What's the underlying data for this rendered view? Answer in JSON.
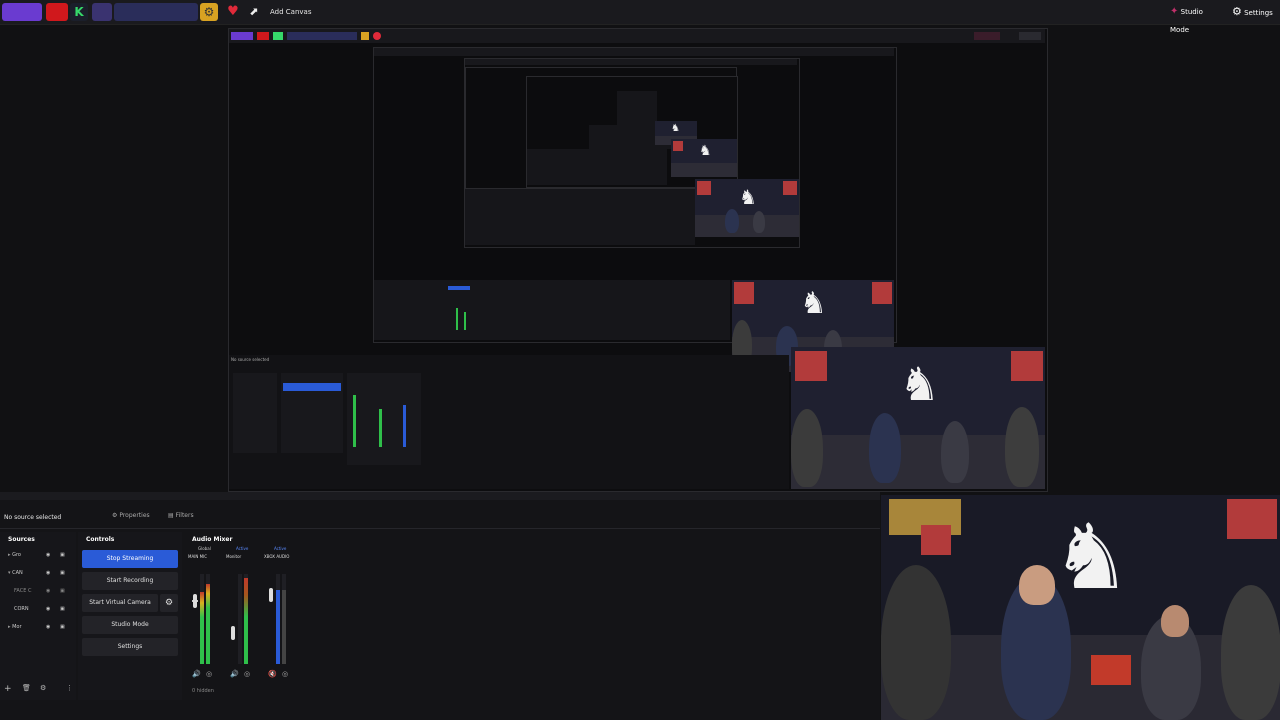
{
  "topbar": {
    "add_canvas": "Add Canvas",
    "studio_mode": "Studio Mode",
    "settings": "Settings"
  },
  "dock": {
    "no_source": "No source selected",
    "properties": "Properties",
    "filters": "Filters",
    "sources_title": "Sources",
    "controls_title": "Controls",
    "mixer_title": "Audio Mixer",
    "sources": [
      {
        "label": "Gro"
      },
      {
        "label": "CAN"
      },
      {
        "label": "FACE C"
      },
      {
        "label": "CORN"
      },
      {
        "label": "Mor"
      }
    ],
    "controls": {
      "stop_streaming": "Stop Streaming",
      "start_recording": "Start Recording",
      "start_virtual_camera": "Start Virtual Camera",
      "studio_mode": "Studio Mode",
      "settings": "Settings"
    },
    "mixer": {
      "tabs": [
        "Global",
        "Active",
        "Active"
      ],
      "channels": [
        "MAIN MIC",
        "Monitor",
        "XBOX AUDIO"
      ],
      "hidden": "0 hidden"
    }
  },
  "colors": {
    "accent": "#2a5bd7",
    "meter_green": "#2fbf4a",
    "meter_red": "#c0392b"
  }
}
